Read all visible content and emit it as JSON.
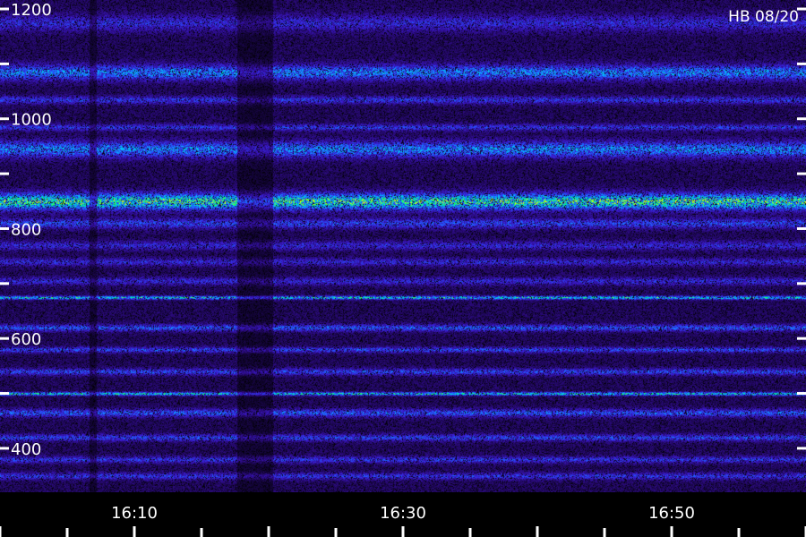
{
  "chart_data": {
    "type": "heatmap",
    "title": "",
    "xlabel": "",
    "ylabel": "",
    "stamp": "HB 08/20",
    "y_range": [
      320,
      1200
    ],
    "y_ticks": [
      {
        "value": 1200,
        "label": "1200"
      },
      {
        "value": 1000,
        "label": "1000"
      },
      {
        "value": 800,
        "label": "800"
      },
      {
        "value": 600,
        "label": "600"
      },
      {
        "value": 400,
        "label": "400"
      }
    ],
    "y_minor_ticks": [
      1100,
      900,
      700,
      500,
      300
    ],
    "x_ticks": [
      {
        "value": "16:10",
        "label": "16:10"
      },
      {
        "value": "16:30",
        "label": "16:30"
      },
      {
        "value": "16:50",
        "label": "16:50"
      }
    ],
    "x_range_minutes": [
      "16:10",
      "16:50"
    ],
    "bands": [
      {
        "center": 1175,
        "width": 30,
        "intensity": 0.3
      },
      {
        "center": 1085,
        "width": 28,
        "intensity": 0.55
      },
      {
        "center": 1035,
        "width": 14,
        "intensity": 0.35
      },
      {
        "center": 985,
        "width": 12,
        "intensity": 0.35
      },
      {
        "center": 945,
        "width": 30,
        "intensity": 0.55
      },
      {
        "center": 850,
        "width": 30,
        "intensity": 0.85
      },
      {
        "center": 810,
        "width": 18,
        "intensity": 0.4
      },
      {
        "center": 770,
        "width": 16,
        "intensity": 0.3
      },
      {
        "center": 740,
        "width": 14,
        "intensity": 0.3
      },
      {
        "center": 705,
        "width": 14,
        "intensity": 0.3
      },
      {
        "center": 675,
        "width": 6,
        "intensity": 0.75
      },
      {
        "center": 620,
        "width": 12,
        "intensity": 0.45
      },
      {
        "center": 580,
        "width": 10,
        "intensity": 0.4
      },
      {
        "center": 540,
        "width": 12,
        "intensity": 0.4
      },
      {
        "center": 500,
        "width": 6,
        "intensity": 0.75
      },
      {
        "center": 465,
        "width": 14,
        "intensity": 0.45
      },
      {
        "center": 420,
        "width": 12,
        "intensity": 0.4
      },
      {
        "center": 380,
        "width": 12,
        "intensity": 0.35
      },
      {
        "center": 350,
        "width": 12,
        "intensity": 0.35
      }
    ],
    "colormap": [
      "#000000",
      "#2a0a7a",
      "#3a1bd0",
      "#1f5cff",
      "#00c8ff",
      "#00ff66",
      "#ffff00",
      "#ff3300"
    ]
  }
}
